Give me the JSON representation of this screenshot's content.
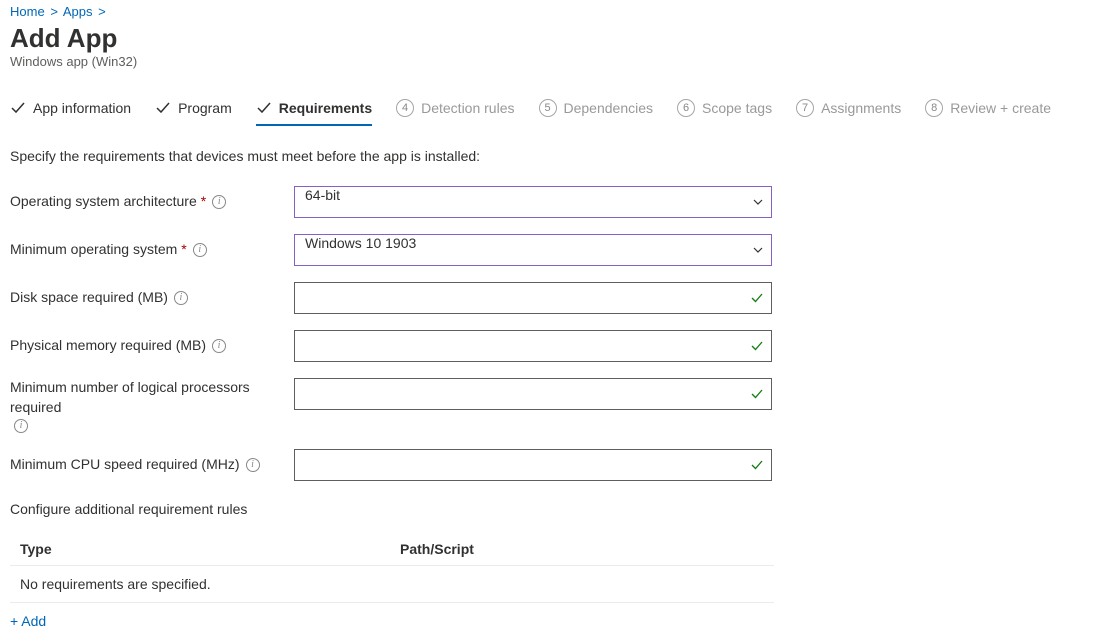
{
  "breadcrumb": {
    "home": "Home",
    "apps": "Apps"
  },
  "pageTitle": "Add App",
  "pageSubtitle": "Windows app (Win32)",
  "tabs": {
    "t1": "App information",
    "t2": "Program",
    "t3": "Requirements",
    "t4": "Detection rules",
    "t5": "Dependencies",
    "t6": "Scope tags",
    "t7": "Assignments",
    "t8": "Review + create",
    "n4": "4",
    "n5": "5",
    "n6": "6",
    "n7": "7",
    "n8": "8"
  },
  "description": "Specify the requirements that devices must meet before the app is installed:",
  "fields": {
    "osArch": {
      "label": "Operating system architecture",
      "value": "64-bit"
    },
    "minOs": {
      "label": "Minimum operating system",
      "value": "Windows 10 1903"
    },
    "disk": {
      "label": "Disk space required (MB)",
      "value": ""
    },
    "mem": {
      "label": "Physical memory required (MB)",
      "value": ""
    },
    "cpuCount": {
      "label": "Minimum number of logical processors required",
      "value": ""
    },
    "cpuSpeed": {
      "label": "Minimum CPU speed required (MHz)",
      "value": ""
    }
  },
  "rulesSection": {
    "heading": "Configure additional requirement rules",
    "colType": "Type",
    "colPath": "Path/Script",
    "empty": "No requirements are specified.",
    "add": "+ Add"
  }
}
